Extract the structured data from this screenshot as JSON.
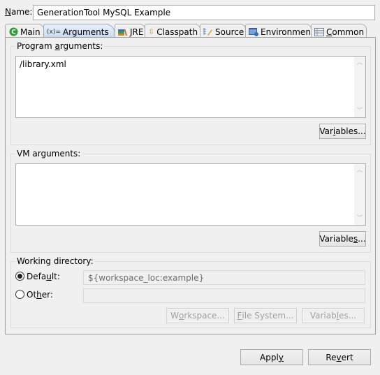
{
  "name": {
    "label_prefix": "",
    "label_mnemonic": "N",
    "label_rest": "ame:",
    "value": "GenerationTool MySQL Example"
  },
  "tabs": [
    {
      "label": "Main",
      "icon": "main-launch-icon",
      "active": false
    },
    {
      "label": "Arguments",
      "icon": "arguments-icon",
      "icon_text": "(x)=",
      "active": true
    },
    {
      "label": "JRE",
      "icon": "jre-library-icon",
      "active": false
    },
    {
      "label": "Classpath",
      "icon": "classpath-icon",
      "active": false
    },
    {
      "label": "Source",
      "icon": "source-icon",
      "active": false
    },
    {
      "label": "Environment",
      "icon": "environment-icon",
      "active": false
    },
    {
      "label": "Common",
      "icon": "common-icon",
      "active": false,
      "mnemonic": "C",
      "rest": "ommon"
    }
  ],
  "program_args": {
    "label_a": "Program ",
    "label_m": "a",
    "label_b": "rguments:",
    "value": "/library.xml",
    "variables_a": "Var",
    "variables_m": "i",
    "variables_b": "ables..."
  },
  "vm_args": {
    "label": "VM arguments:",
    "value": "",
    "variables_a": "Variable",
    "variables_m": "s",
    "variables_b": "..."
  },
  "working_dir": {
    "label": "Working directory:",
    "default_a": "Defa",
    "default_m": "u",
    "default_b": "lt:",
    "default_selected": true,
    "default_value": "${workspace_loc:example}",
    "other_a": "Ot",
    "other_m": "h",
    "other_b": "er:",
    "other_selected": false,
    "other_value": "",
    "workspace_a": "W",
    "workspace_m": "o",
    "workspace_b": "rkspace...",
    "filesystem_m": "F",
    "filesystem_b": "ile System...",
    "variables_a": "Variab",
    "variables_m": "l",
    "variables_b": "es..."
  },
  "footer": {
    "apply_a": "Appl",
    "apply_m": "y",
    "revert_a": "Re",
    "revert_m": "v",
    "revert_b": "ert"
  }
}
